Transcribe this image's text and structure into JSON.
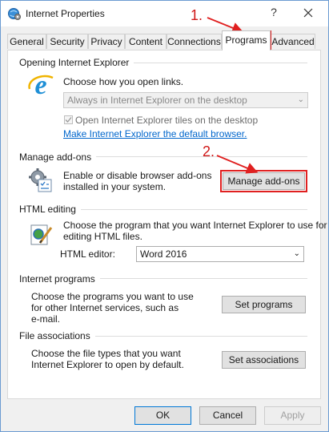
{
  "window": {
    "title": "Internet Properties"
  },
  "titlebar": {
    "help_label": "?"
  },
  "tabs": [
    {
      "label": "General"
    },
    {
      "label": "Security"
    },
    {
      "label": "Privacy"
    },
    {
      "label": "Content"
    },
    {
      "label": "Connections"
    },
    {
      "label": "Programs"
    },
    {
      "label": "Advanced"
    }
  ],
  "opening_ie": {
    "title": "Opening Internet Explorer",
    "choose_text": "Choose how you open links.",
    "dropdown_value": "Always in Internet Explorer on the desktop",
    "checkbox_label": "Open Internet Explorer tiles on the desktop",
    "checkbox_checked": true,
    "default_link": "Make Internet Explorer the default browser."
  },
  "manage_addons": {
    "title": "Manage add-ons",
    "description_line1": "Enable or disable browser add-ons",
    "description_line2": "installed in your system.",
    "button_label": "Manage add-ons"
  },
  "html_editing": {
    "title": "HTML editing",
    "description_line1": "Choose the program that you want Internet Explorer to use for",
    "description_line2": "editing HTML files.",
    "editor_label": "HTML editor:",
    "editor_value": "Word 2016"
  },
  "internet_programs": {
    "title": "Internet programs",
    "description_line1": "Choose the programs you want to use",
    "description_line2": "for other Internet services, such as",
    "description_line3": "e-mail.",
    "button_label": "Set programs"
  },
  "file_associations": {
    "title": "File associations",
    "description_line1": "Choose the file types that you want",
    "description_line2": "Internet Explorer to open by default.",
    "button_label": "Set associations"
  },
  "footer": {
    "ok_label": "OK",
    "cancel_label": "Cancel",
    "apply_label": "Apply"
  },
  "annotations": {
    "step1": "1.",
    "step2": "2.",
    "color": "#e02020"
  },
  "colors": {
    "link": "#0066cc",
    "ie_blue": "#1e8fd6",
    "ie_ring": "#f0b400"
  }
}
